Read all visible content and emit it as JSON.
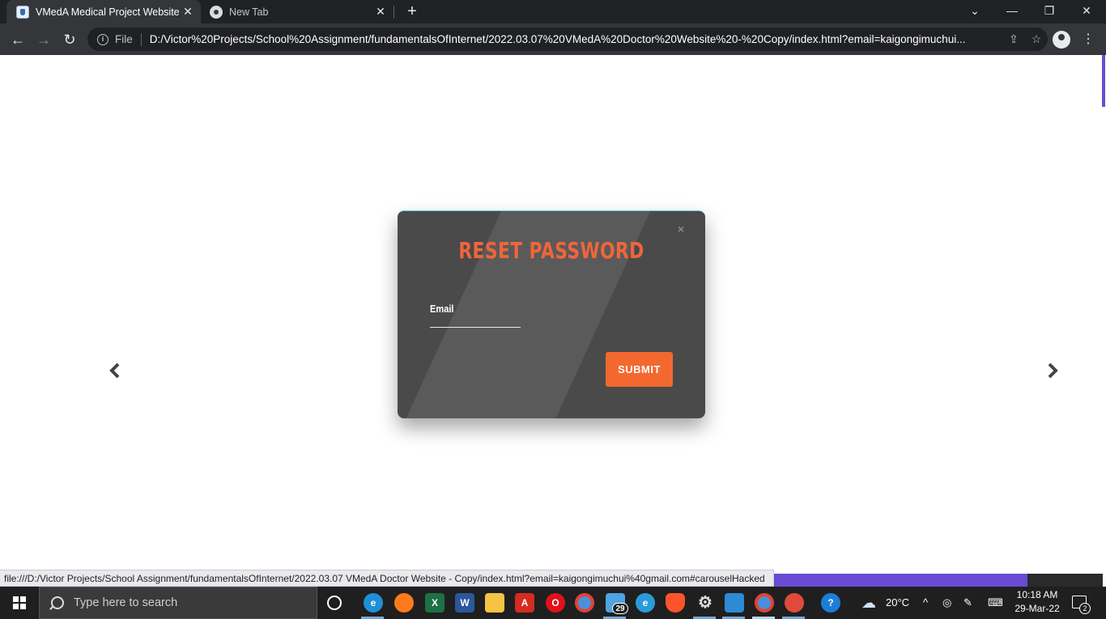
{
  "browser": {
    "tabs": [
      {
        "title": "VMedA Medical Project Website",
        "active": true
      },
      {
        "title": "New Tab",
        "active": false
      }
    ],
    "new_tab_glyph": "+",
    "window_controls": {
      "dropdown": "⌄",
      "minimize": "—",
      "restore": "❐",
      "close": "✕"
    },
    "nav": {
      "back": "←",
      "forward": "→",
      "reload": "↻"
    },
    "omnibox": {
      "scheme_label": "File",
      "url": "D:/Victor%20Projects/School%20Assignment/fundamentalsOfInternet/2022.03.07%20VMedA%20Doctor%20Website%20-%20Copy/index.html?email=kaigongimuchui..."
    },
    "menu_glyph": "⋮"
  },
  "modal": {
    "title": "RESET PASSWORD",
    "close_glyph": "×",
    "email_label": "Email",
    "email_value": "",
    "submit_label": "SUBMIT"
  },
  "carousel": {
    "prev_glyph": "‹",
    "next_glyph": "›"
  },
  "status_bar": {
    "text": "file:///D:/Victor Projects/School Assignment/fundamentalsOfInternet/2022.03.07 VMedA Doctor Website - Copy/index.html?email=kaigongimuchui%40gmail.com#carouselHacked"
  },
  "taskbar": {
    "search_placeholder": "Type here to search",
    "apps": [
      {
        "name": "cortana",
        "color": "#ffffff"
      },
      {
        "name": "edge",
        "color": "#1f8fd8"
      },
      {
        "name": "firefox",
        "color": "#ff7a1a"
      },
      {
        "name": "excel",
        "color": "#1d7044"
      },
      {
        "name": "word",
        "color": "#2b579a"
      },
      {
        "name": "file-explorer",
        "color": "#f6c343"
      },
      {
        "name": "acrobat",
        "color": "#d62b20"
      },
      {
        "name": "opera",
        "color": "#e0111c"
      },
      {
        "name": "chrome",
        "color": "#4a90d9"
      },
      {
        "name": "files",
        "color": "#4fa3e0"
      },
      {
        "name": "internet-explorer",
        "color": "#2b9bd8"
      },
      {
        "name": "brave",
        "color": "#fb542b"
      },
      {
        "name": "settings",
        "color": "#dddddd"
      },
      {
        "name": "vscode",
        "color": "#2d8ad4"
      },
      {
        "name": "chrome",
        "color": "#4a90d9"
      },
      {
        "name": "snipping-tool",
        "color": "#e04a3d"
      },
      {
        "name": "help",
        "color": "#1c7ed6"
      }
    ],
    "files_badge": "29",
    "weather": "20°C",
    "time": "10:18 AM",
    "date": "29-Mar-22",
    "notification_count": "2"
  }
}
